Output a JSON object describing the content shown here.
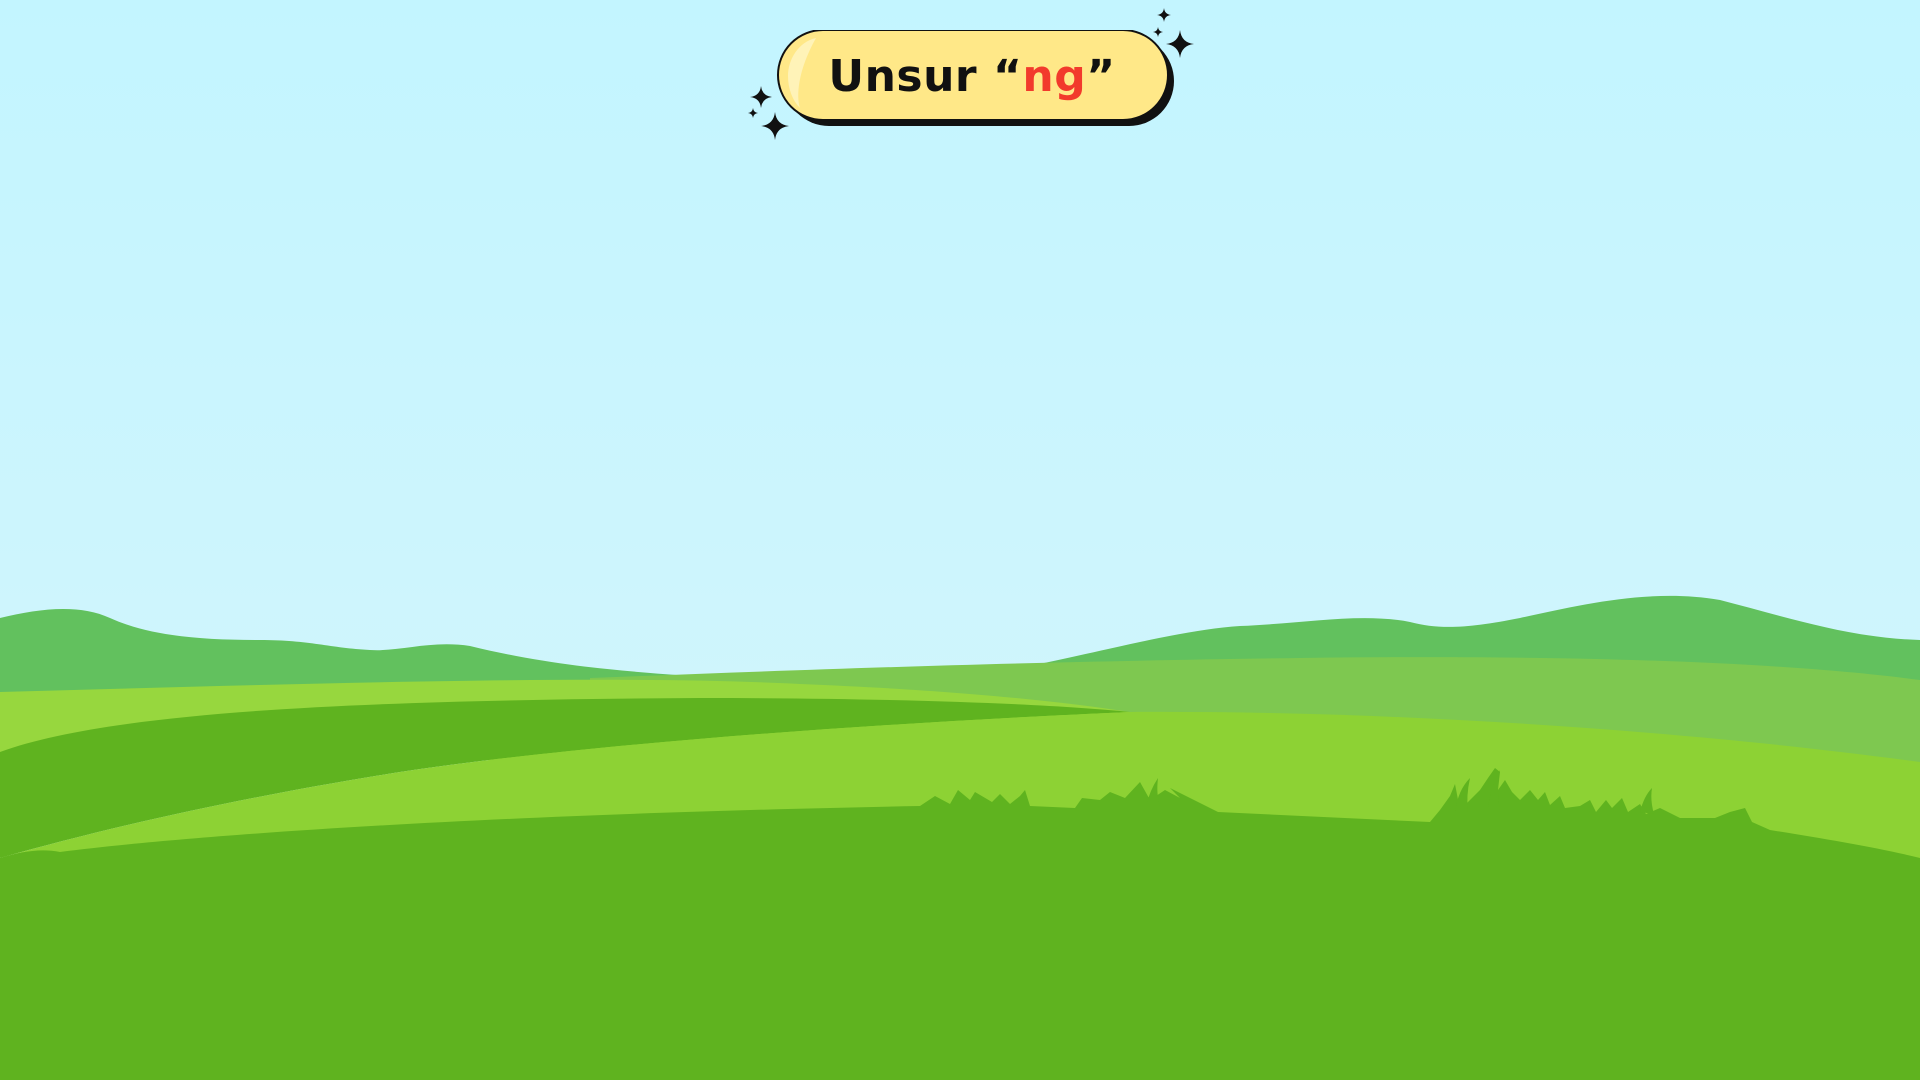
{
  "title": {
    "prefix": "Unsur ",
    "open_quote": "“",
    "highlight": "ng",
    "close_quote": "”"
  },
  "colors": {
    "sky_top": "#c3f5ff",
    "sky_bottom": "#d6f5fb",
    "far_hills": "#62c15e",
    "mid_field": "#7ec850",
    "light_field": "#8dd234",
    "bright_field": "#97d73e",
    "dark_field": "#5fb31f",
    "badge_fill": "#ffe888",
    "badge_highlight": "#fff3b8",
    "badge_outline": "#111111",
    "accent_text": "#f23a2c"
  },
  "icons": {
    "sparkles": "four-point-star-sparkle-icon"
  }
}
